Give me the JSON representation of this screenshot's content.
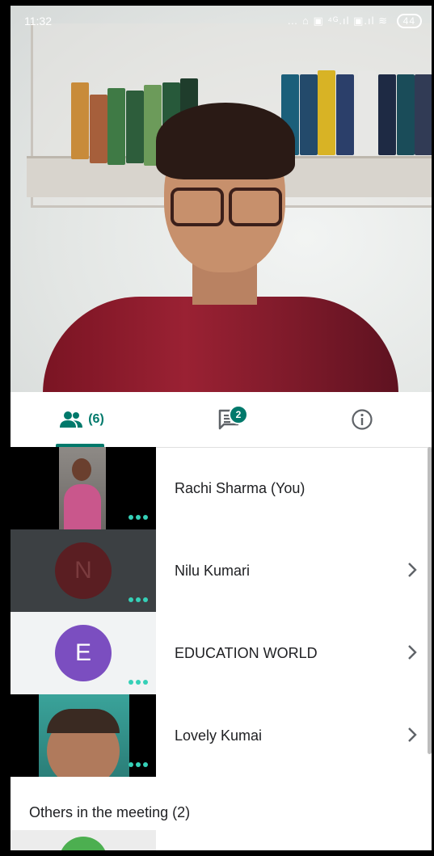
{
  "status_bar": {
    "time": "11:32",
    "icons_text": "… ⌂ ▣ ⁴ᴳ.ıl ▣.ıl ≋",
    "battery": "44"
  },
  "tabs": {
    "people_label": "(6)",
    "chat_badge": "2",
    "people_icon": "people-icon",
    "chat_icon": "chat-icon",
    "info_icon": "info-icon"
  },
  "participants": [
    {
      "name": "Rachi Sharma (You)",
      "avatar_letter": "",
      "has_chevron": false
    },
    {
      "name": "Nilu Kumari",
      "avatar_letter": "N",
      "has_chevron": true
    },
    {
      "name": "EDUCATION WORLD",
      "avatar_letter": "E",
      "has_chevron": true
    },
    {
      "name": "Lovely Kumai",
      "avatar_letter": "",
      "has_chevron": true
    }
  ],
  "others_heading": "Others in the meeting (2)",
  "colors": {
    "accent": "#00796b",
    "dots": "#35d0b7",
    "avatar_n_bg": "#5a1e22",
    "avatar_e_bg": "#7b4ec0"
  }
}
